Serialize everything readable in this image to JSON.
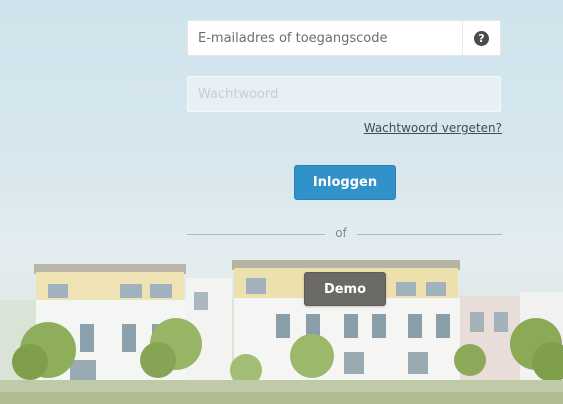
{
  "login": {
    "email_placeholder": "E-mailadres of toegangscode",
    "help_icon_glyph": "?",
    "password_placeholder": "Wachtwoord",
    "forgot_password_label": "Wachtwoord vergeten?",
    "login_button_label": "Inloggen",
    "separator_label": "of",
    "demo_button_label": "Demo"
  },
  "colors": {
    "primary_button": "#3191c9",
    "demo_button": "#6c6a66",
    "help_icon": "#4b4b4b"
  },
  "icons": {
    "help": "question-circle-icon"
  },
  "background": {
    "description_icon": "houses-landscape-photo"
  }
}
